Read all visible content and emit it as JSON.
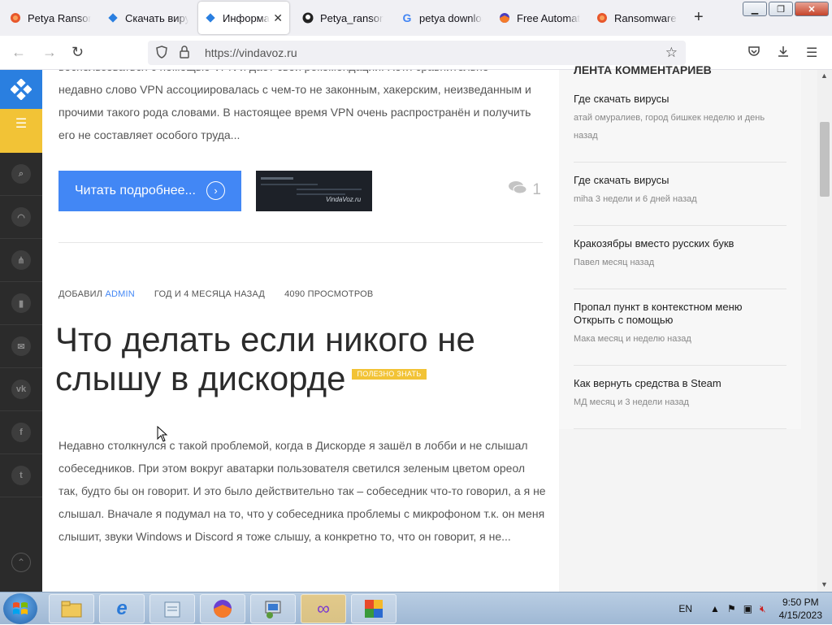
{
  "tabs": [
    {
      "label": "Petya Ransomware",
      "icon": "firefox-red-icon",
      "active": false
    },
    {
      "label": "Скачать вирусы",
      "icon": "vindavoz-icon",
      "active": false
    },
    {
      "label": "Информация",
      "icon": "vindavoz-icon",
      "active": true
    },
    {
      "label": "Petya_ransomware",
      "icon": "github-icon",
      "active": false
    },
    {
      "label": "petya download",
      "icon": "google-icon",
      "active": false
    },
    {
      "label": "Free Automated",
      "icon": "firefox-icon",
      "active": false
    },
    {
      "label": "Ransomware Samples",
      "icon": "firefox-red-icon",
      "active": false
    }
  ],
  "tab_close": "✕",
  "new_tab": "+",
  "address": {
    "url": "https://vindavoz.ru"
  },
  "excerpt_lines": [
    "воспользоваться с помощью VPN и даёт свои рекомендации. Хотя сравнительно",
    "недавно слово VPN ассоциировалась с чем-то не законным, хакерским, неизведанным и",
    "прочими такого рода словами. В настоящее время VPN очень распространён и получить",
    "его не составляет особого труда..."
  ],
  "read_more": {
    "label": "Читать подробнее...",
    "arrow": "›"
  },
  "thumbnail": {
    "brand": "VindaVoz.ru"
  },
  "comments_count": "1",
  "meta": {
    "added_by": "ДОБАВИЛ",
    "author": "ADMIN",
    "date": "ГОД И 4 МЕСЯЦА НАЗАД",
    "views": "4090 ПРОСМОТРОВ"
  },
  "article": {
    "title": "Что делать если никого не слышу в дискорде",
    "tag": "ПОЛЕЗНО ЗНАТЬ",
    "body": "Недавно столкнулся с такой проблемой, когда в Дискорде я зашёл в лобби и не слышал собеседников. При этом вокруг аватарки пользователя светился зеленым цветом ореол так, будто бы он говорит. И это было действительно так – собеседник что-то говорил, а я не слышал. Вначале я подумал на то, что у собеседника проблемы с микрофоном т.к. он меня слышит, звуки Windows и Discord я тоже слышу, а конкретно то, что он говорит, я не..."
  },
  "sidebar": {
    "heading": "ЛЕНТА КОММЕНТАРИЕВ",
    "items": [
      {
        "title": "Где скачать вирусы",
        "sub": "атай омуралиев, город бишкек неделю и день назад"
      },
      {
        "title": "Где скачать вирусы",
        "sub": "miha 3 недели и 6 дней назад"
      },
      {
        "title": "Кракозябры вместо русских букв",
        "sub": "Павел месяц назад"
      },
      {
        "title": "Пропал пункт в контекстном меню Открыть с помощью",
        "sub": "Мака месяц и неделю назад"
      },
      {
        "title": "Как вернуть средства в Steam",
        "sub": "МД месяц и 3 недели назад"
      }
    ]
  },
  "left_social": [
    "search-icon",
    "rss-icon",
    "sitemap-icon",
    "bookmark-icon",
    "mail-icon",
    "vk-icon",
    "facebook-icon",
    "twitter-icon"
  ],
  "taskbar": {
    "lang": "EN",
    "time": "9:50 PM",
    "date": "4/15/2023"
  },
  "colors": {
    "accent_blue": "#4287f5",
    "accent_yellow": "#f2c336",
    "sidebar_dark": "#2b2b2b"
  }
}
